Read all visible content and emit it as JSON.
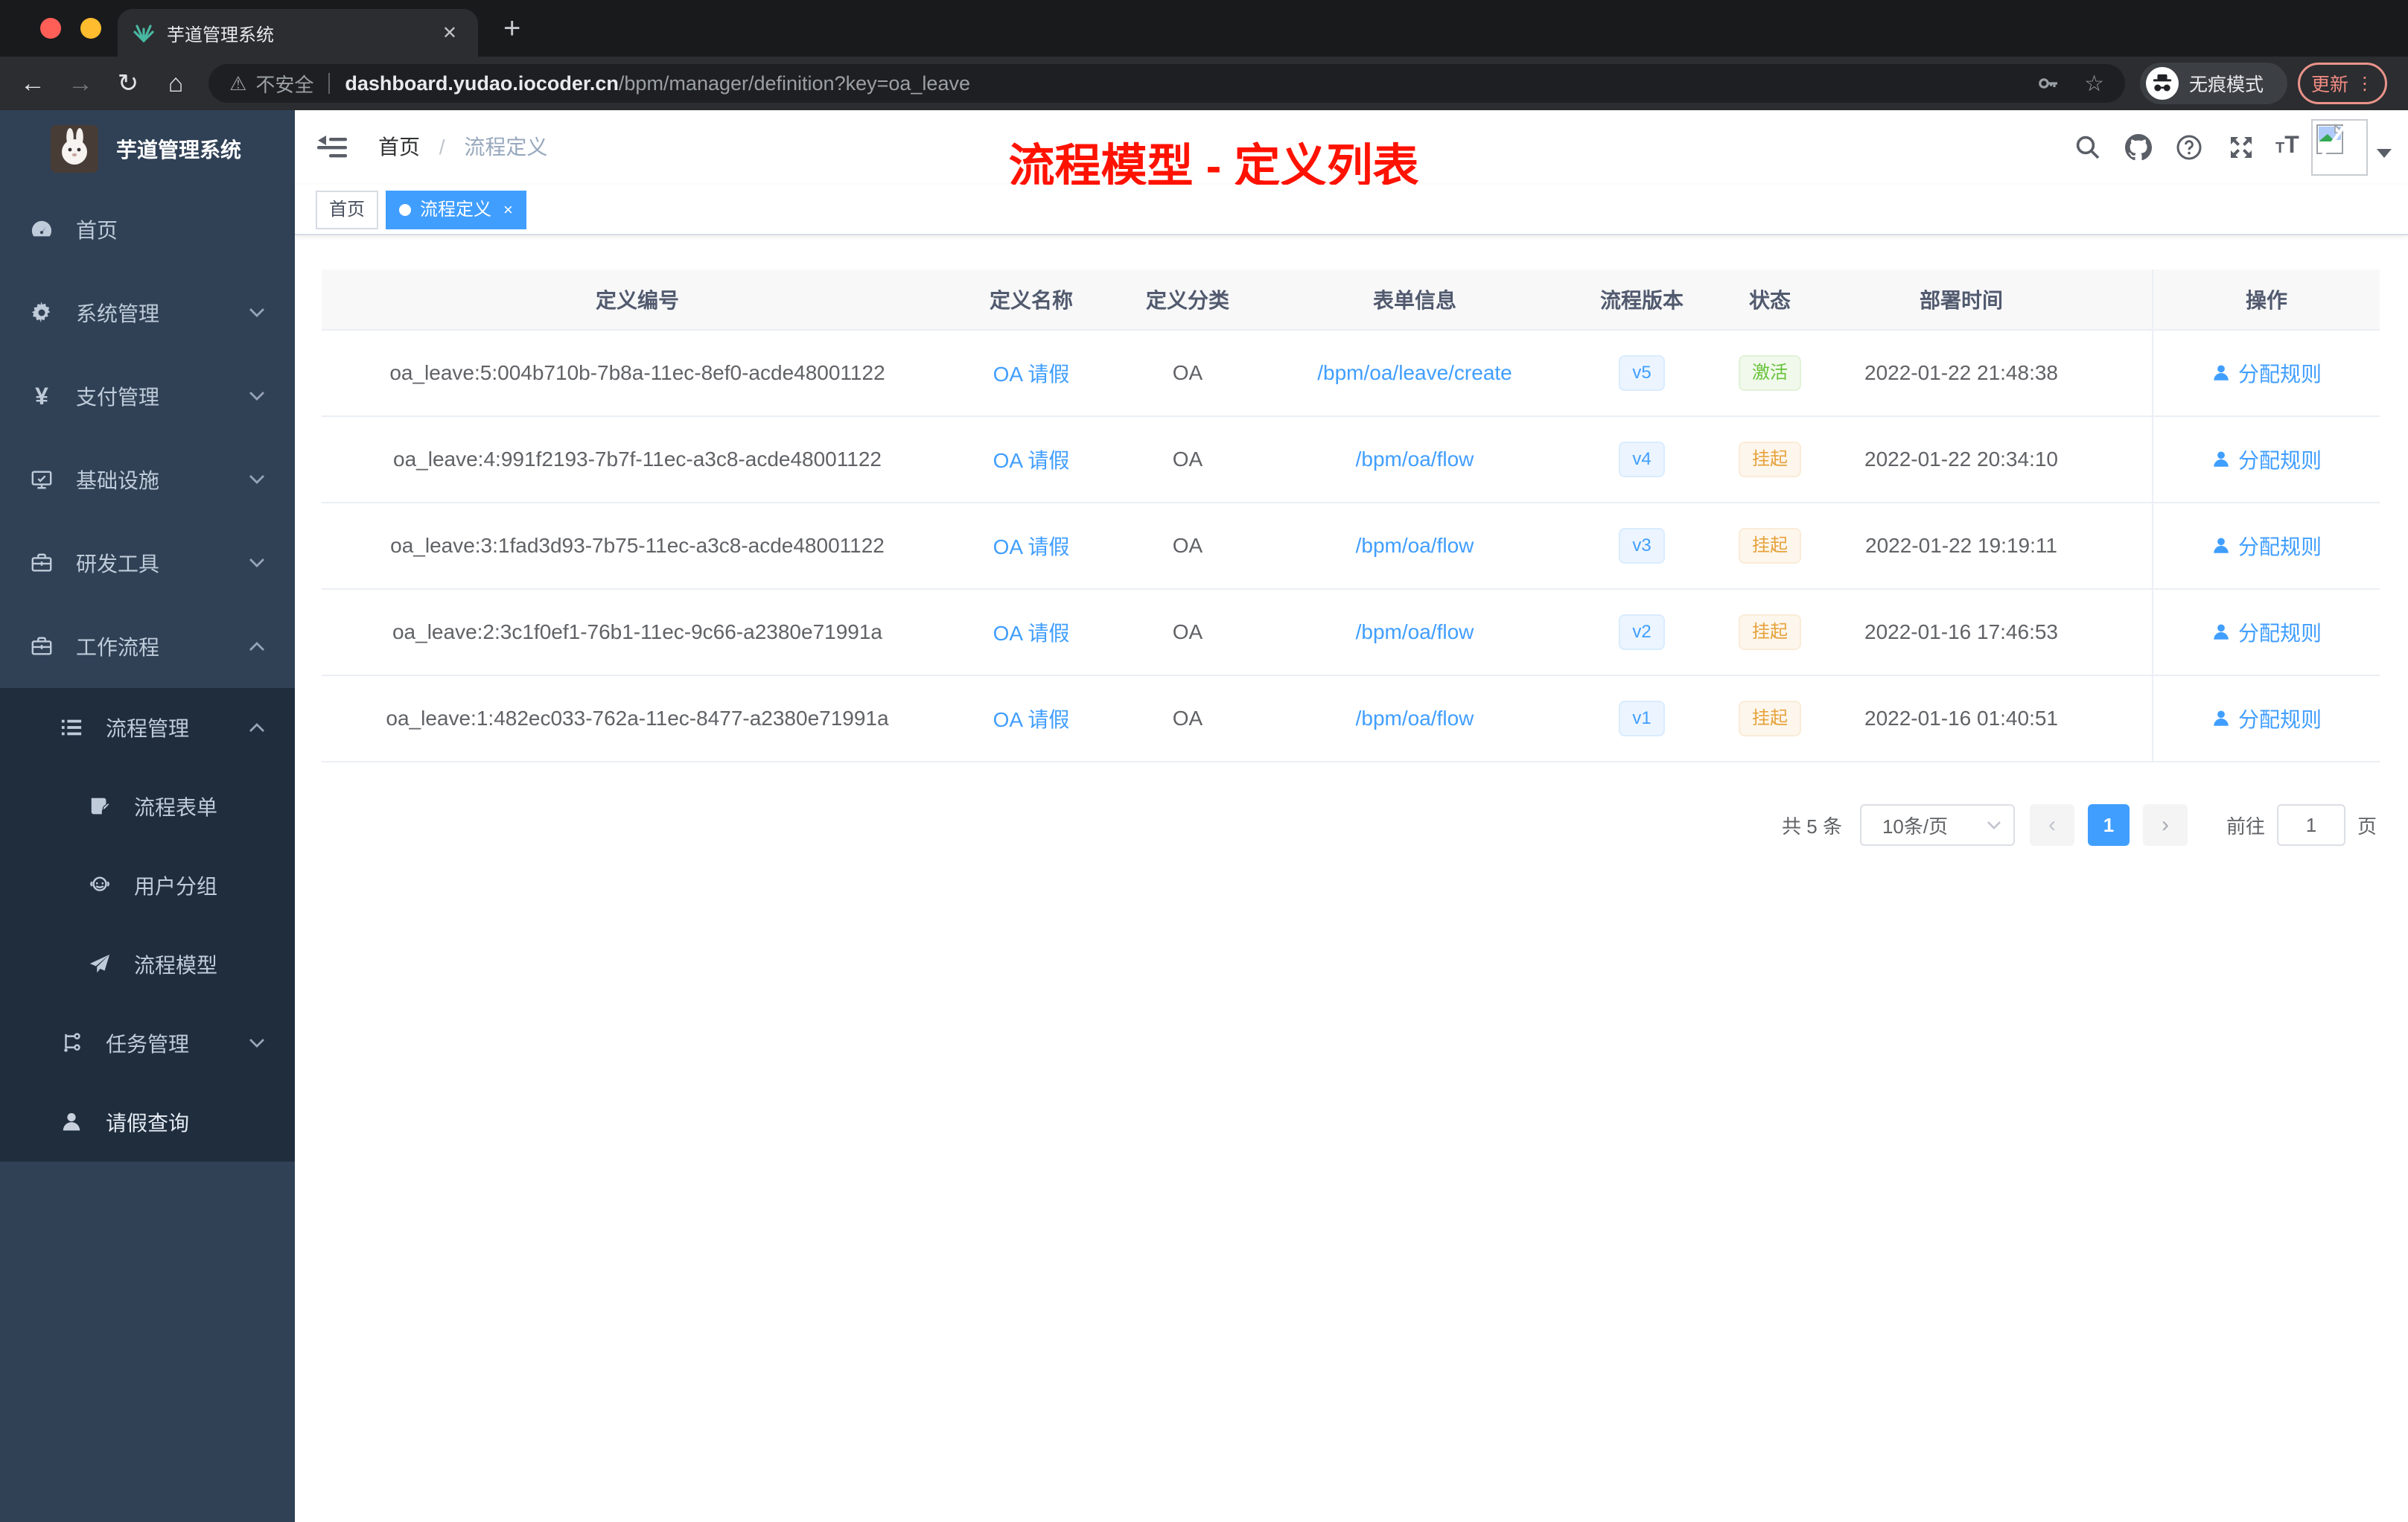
{
  "browser": {
    "traffic_lights": {
      "red": "#ff5f57",
      "yellow": "#febc2e",
      "green": "#28c840"
    },
    "tab_title": "芋道管理系统",
    "tab_close": "✕",
    "new_tab": "+",
    "nav": {
      "back": "←",
      "forward": "→",
      "reload": "↻",
      "home": "⌂"
    },
    "url_warning_icon": "⚠",
    "url_warning": "不安全",
    "url_host": "dashboard.yudao.iocoder.cn",
    "url_path": "/bpm/manager/definition?key=oa_leave",
    "star": "☆",
    "incognito_label": "无痕模式",
    "update_label": "更新",
    "menu_dots": "⋮"
  },
  "sidebar": {
    "logo_title": "芋道管理系统",
    "menu": [
      {
        "label": "首页",
        "icon": "dashboard-icon"
      },
      {
        "label": "系统管理",
        "icon": "gear-icon"
      },
      {
        "label": "支付管理",
        "icon": "yen-icon"
      },
      {
        "label": "基础设施",
        "icon": "monitor-icon"
      },
      {
        "label": "研发工具",
        "icon": "toolbox-icon"
      },
      {
        "label": "工作流程",
        "icon": "briefcase-icon"
      },
      {
        "label": "流程管理",
        "icon": "list-icon"
      },
      {
        "label": "流程表单",
        "icon": "form-icon"
      },
      {
        "label": "用户分组",
        "icon": "people-icon"
      },
      {
        "label": "流程模型",
        "icon": "send-icon"
      },
      {
        "label": "任务管理",
        "icon": "tree-icon"
      },
      {
        "label": "请假查询",
        "icon": "user-icon"
      }
    ]
  },
  "header": {
    "breadcrumb_home": "首页",
    "breadcrumb_sep": "/",
    "breadcrumb_current": "流程定义",
    "annotation": "流程模型 - 定义列表"
  },
  "tags": {
    "home": "首页",
    "active": "流程定义",
    "close": "×"
  },
  "table": {
    "columns": [
      "定义编号",
      "定义名称",
      "定义分类",
      "表单信息",
      "流程版本",
      "状态",
      "部署时间",
      "操作"
    ],
    "rows": [
      {
        "id": "oa_leave:5:004b710b-7b8a-11ec-8ef0-acde48001122",
        "name": "OA 请假",
        "category": "OA",
        "form": "/bpm/oa/leave/create",
        "version": "v5",
        "status": "激活",
        "time": "2022-01-22 21:48:38",
        "action": "分配规则"
      },
      {
        "id": "oa_leave:4:991f2193-7b7f-11ec-a3c8-acde48001122",
        "name": "OA 请假",
        "category": "OA",
        "form": "/bpm/oa/flow",
        "version": "v4",
        "status": "挂起",
        "time": "2022-01-22 20:34:10",
        "action": "分配规则"
      },
      {
        "id": "oa_leave:3:1fad3d93-7b75-11ec-a3c8-acde48001122",
        "name": "OA 请假",
        "category": "OA",
        "form": "/bpm/oa/flow",
        "version": "v3",
        "status": "挂起",
        "time": "2022-01-22 19:19:11",
        "action": "分配规则"
      },
      {
        "id": "oa_leave:2:3c1f0ef1-76b1-11ec-9c66-a2380e71991a",
        "name": "OA 请假",
        "category": "OA",
        "form": "/bpm/oa/flow",
        "version": "v2",
        "status": "挂起",
        "time": "2022-01-16 17:46:53",
        "action": "分配规则"
      },
      {
        "id": "oa_leave:1:482ec033-762a-11ec-8477-a2380e71991a",
        "name": "OA 请假",
        "category": "OA",
        "form": "/bpm/oa/flow",
        "version": "v1",
        "status": "挂起",
        "time": "2022-01-16 01:40:51",
        "action": "分配规则"
      }
    ]
  },
  "pagination": {
    "total": "共 5 条",
    "page_size": "10条/页",
    "prev": "‹",
    "page": "1",
    "next": "›",
    "goto_label": "前往",
    "goto_value": "1",
    "unit": "页"
  },
  "colors": {
    "accent": "#409eff",
    "success": "#67c23a",
    "warning": "#e6a23c",
    "annotation": "#ff1200",
    "sidebar_bg": "#304156",
    "submenu_bg": "#1f2d3d"
  }
}
